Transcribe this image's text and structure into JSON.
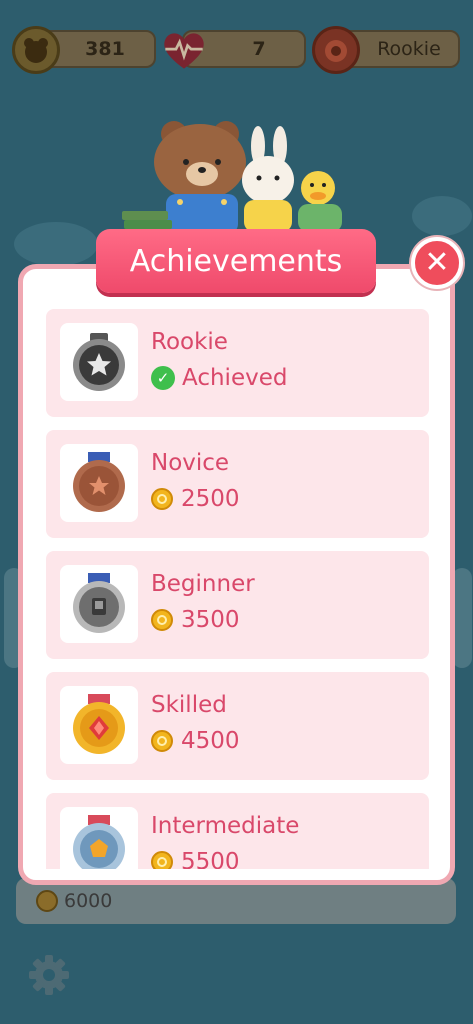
{
  "top_bar": {
    "coins": "381",
    "lives": "7",
    "rank": "Rookie"
  },
  "modal": {
    "title": "Achievements",
    "achievements": [
      {
        "name": "Rookie",
        "status": "Achieved",
        "medal": "gray-star-medal"
      },
      {
        "name": "Novice",
        "cost": "2500",
        "medal": "bronze-medal"
      },
      {
        "name": "Beginner",
        "cost": "3500",
        "medal": "silver-medal"
      },
      {
        "name": "Skilled",
        "cost": "4500",
        "medal": "gold-medal"
      },
      {
        "name": "Intermediate",
        "cost": "5500",
        "medal": "blue-medal"
      }
    ]
  },
  "background": {
    "bottom_value": "6000"
  },
  "colors": {
    "accent_pink": "#ef4a6b",
    "card_bg": "#fde6ea",
    "text_pink": "#d9486a",
    "achieved_green": "#3fbf4c"
  }
}
